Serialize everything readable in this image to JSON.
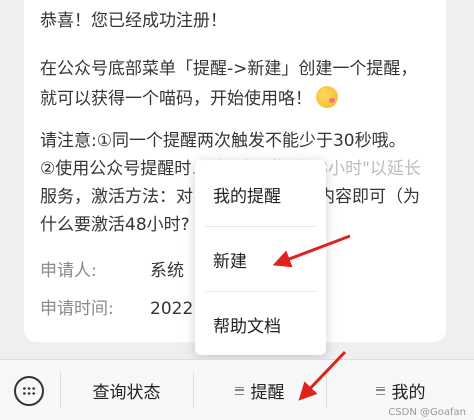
{
  "message": {
    "line1": "恭喜！您已经成功注册！",
    "line2": "在公众号底部菜单「提醒->新建」创建一个提醒，",
    "line3": "就可以获得一个喵码，开始使用咯！",
    "line4": "请注意:①同一个提醒两次触发不能少于30秒哦。",
    "line5_a": "②使用公众号提醒时",
    "line5_b": "…请回复\"激活 48小时\"以延长",
    "line6_a": "服务，激活方法：对",
    "line6_b": "内容即可（为",
    "line7_a": "什么要激活48小时?",
    "line7_b": "）",
    "applicant_label": "申请人:",
    "applicant_value": "系统",
    "time_label": "申请时间:",
    "time_value": "2022"
  },
  "popup": {
    "items": [
      "我的提醒",
      "新建",
      "帮助文档"
    ]
  },
  "menu_bar": {
    "items": [
      "查询状态",
      "提醒",
      "我的"
    ]
  },
  "watermark": "CSDN @Goafan",
  "colors": {
    "arrow": "#e0221a",
    "background": "#efefef"
  }
}
